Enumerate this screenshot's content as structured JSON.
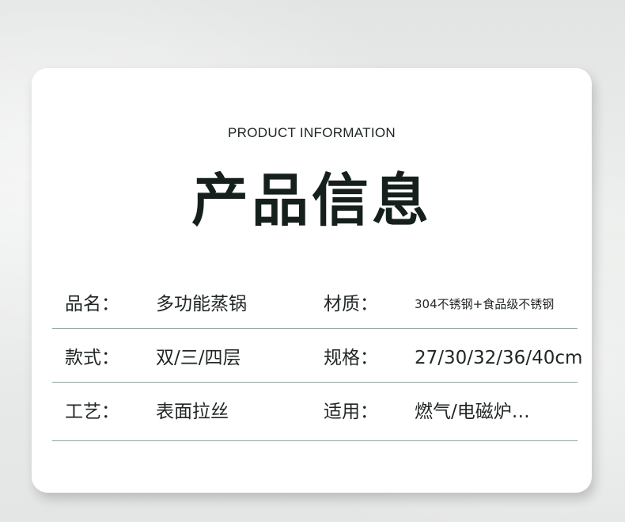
{
  "header": {
    "subtitle": "PRODUCT INFORMATION",
    "title": "产品信息"
  },
  "rows": [
    {
      "label1": "品名：",
      "value1": "多功能蒸锅",
      "label2": "材质：",
      "value2": "304不锈钢+食品级不锈钢"
    },
    {
      "label1": "款式：",
      "value1": "双/三/四层",
      "label2": "规格：",
      "value2": "27/30/32/36/40cm"
    },
    {
      "label1": "工艺：",
      "value1": "表面拉丝",
      "label2": "适用：",
      "value2": "燃气/电磁炉…"
    }
  ]
}
